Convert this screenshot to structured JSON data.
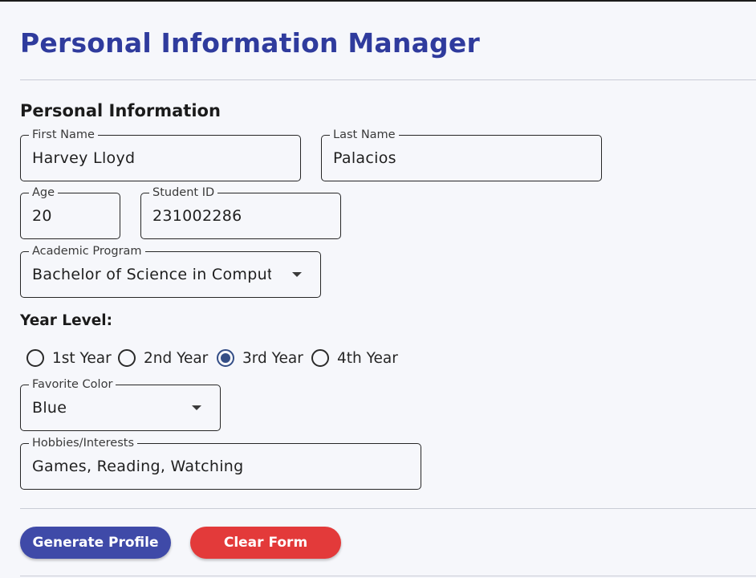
{
  "header": {
    "title": "Personal Information Manager"
  },
  "section": {
    "title": "Personal Information"
  },
  "fields": {
    "first_name": {
      "label": "First Name",
      "value": "Harvey Lloyd"
    },
    "last_name": {
      "label": "Last Name",
      "value": "Palacios"
    },
    "age": {
      "label": "Age",
      "value": "20"
    },
    "student_id": {
      "label": "Student ID",
      "value": "231002286"
    },
    "program": {
      "label": "Academic Program",
      "value": "Bachelor of Science in Compute"
    },
    "favorite_color": {
      "label": "Favorite Color",
      "value": "Blue"
    },
    "hobbies": {
      "label": "Hobbies/Interests",
      "value": "Games, Reading, Watching"
    }
  },
  "year_level": {
    "label": "Year Level:",
    "options": [
      "1st Year",
      "2nd Year",
      "3rd Year",
      "4th Year"
    ],
    "selected": "3rd Year"
  },
  "buttons": {
    "generate": "Generate Profile",
    "clear": "Clear Form"
  },
  "colors": {
    "title": "#2f3b9d",
    "background": "#f6f7fb",
    "generate_button": "#3f4aa8",
    "clear_button": "#e33a3a",
    "radio_selected": "#344e86"
  },
  "icons": {
    "dropdown": "caret-down-icon"
  }
}
